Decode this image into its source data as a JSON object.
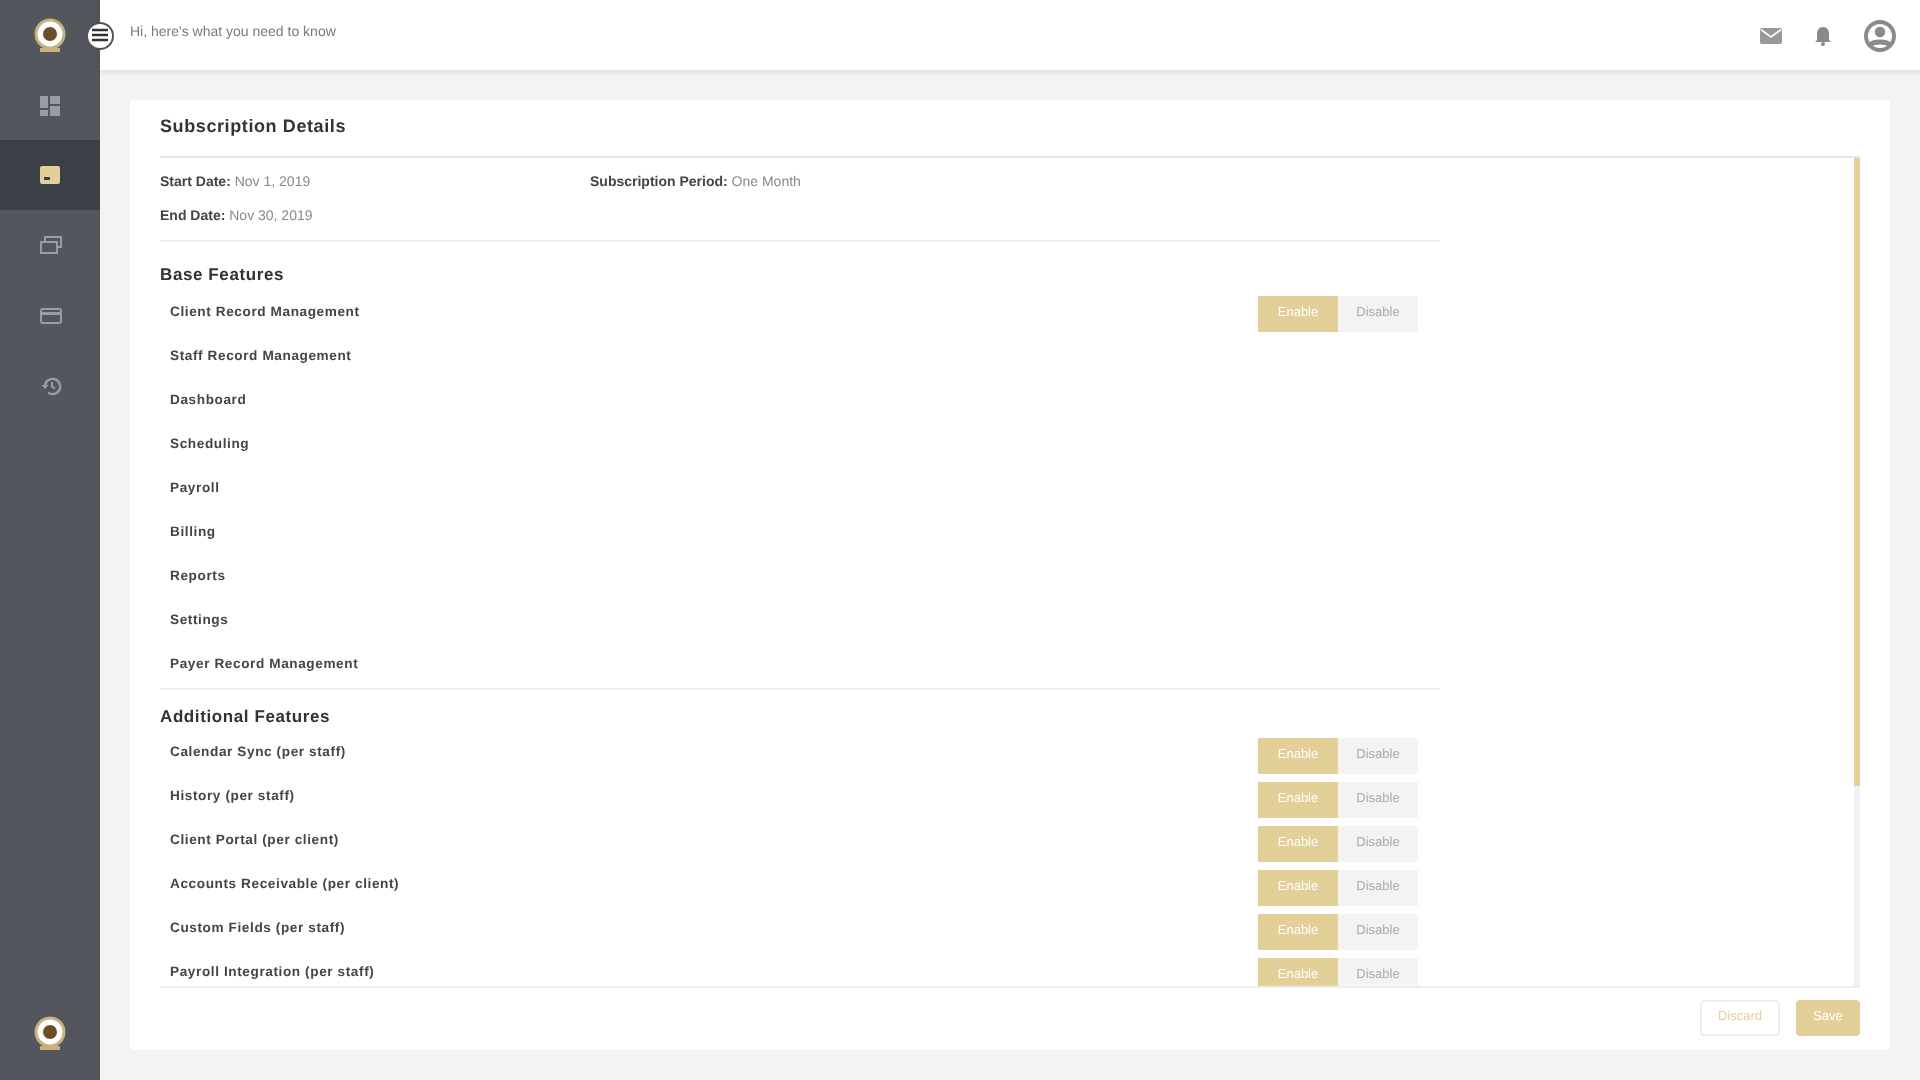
{
  "header": {
    "greeting": "Hi, here's what you need to know"
  },
  "sidebar": {
    "items": [
      {
        "selected": false
      },
      {
        "selected": true
      },
      {
        "selected": false
      },
      {
        "selected": false
      },
      {
        "selected": false
      }
    ]
  },
  "card": {
    "title": "Subscription Details",
    "details": [
      {
        "label": "Start Date:",
        "value": "Nov 1, 2019"
      },
      {
        "label": "Subscription Period:",
        "value": "One Month"
      },
      {
        "label": "End Date:",
        "value": "Nov 30, 2019"
      }
    ],
    "sections": [
      {
        "title": "Base Features",
        "features": [
          {
            "name": "Client Record Management",
            "enabled": true,
            "enable_label": "Enable",
            "disable_label": "Disable"
          },
          {
            "name": "Staff Record Management"
          },
          {
            "name": "Dashboard"
          },
          {
            "name": "Scheduling"
          },
          {
            "name": "Payroll"
          },
          {
            "name": "Billing"
          },
          {
            "name": "Reports"
          },
          {
            "name": "Settings"
          },
          {
            "name": "Payer Record Management"
          }
        ]
      },
      {
        "title": "Additional Features",
        "features": [
          {
            "name": "Calendar Sync (per staff)",
            "enabled": true,
            "enable_label": "Enable",
            "disable_label": "Disable"
          },
          {
            "name": "History (per staff)",
            "enabled": true,
            "enable_label": "Enable",
            "disable_label": "Disable"
          },
          {
            "name": "Client Portal (per client)",
            "enabled": true,
            "enable_label": "Enable",
            "disable_label": "Disable"
          },
          {
            "name": "Accounts Receivable (per client)",
            "enabled": true,
            "enable_label": "Enable",
            "disable_label": "Disable"
          },
          {
            "name": "Custom Fields (per staff)",
            "enabled": true,
            "enable_label": "Enable",
            "disable_label": "Disable"
          },
          {
            "name": "Payroll Integration (per staff)",
            "enabled": true,
            "enable_label": "Enable",
            "disable_label": "Disable"
          }
        ]
      }
    ],
    "buttons": [
      {
        "label": "Discard",
        "kind": "secondary"
      },
      {
        "label": "Save",
        "kind": "primary"
      }
    ]
  }
}
